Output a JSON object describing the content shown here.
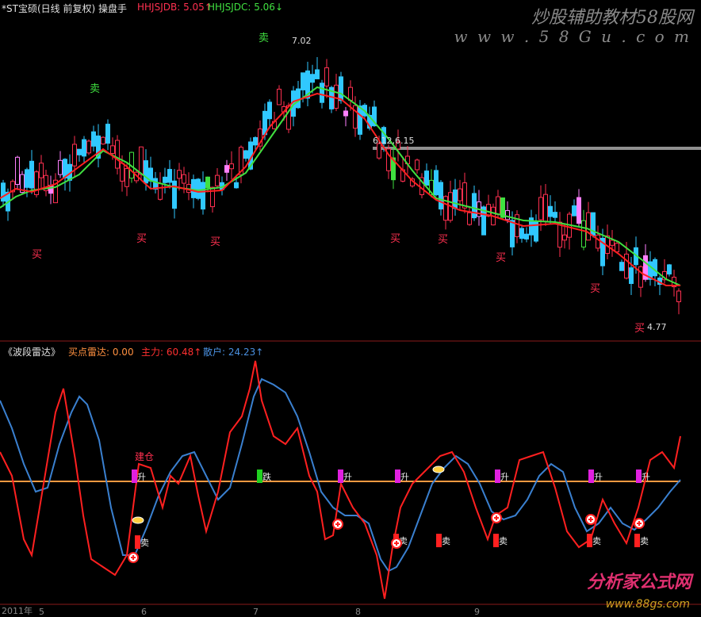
{
  "header": {
    "stock": "*ST宝硕(日线 前复权) 操盘手",
    "ind1": "HHJSJDB: 5.05↑",
    "ind2": "HHJSJDC: 5.06↓"
  },
  "sub_header": {
    "name": "《波段雷达》",
    "ind1": "买点雷达: 0.00",
    "ind2": "主力: 60.48↑",
    "ind3": "散户: 24.23↑"
  },
  "watermark": {
    "top_text": "炒股辅助教材58股网",
    "top_url": "w w w . 5 8 G u . c o m",
    "bottom_text": "分析家公式网",
    "bottom_url": "www.88gs.com"
  },
  "x_labels": [
    "2011年",
    "5",
    "6",
    "7",
    "8",
    "9"
  ],
  "colors": {
    "up": "#ff3050",
    "down": "#30c8ff",
    "ma_fast": "#ff2020",
    "ma_slow": "#40e040",
    "main_force": "#ff2020",
    "retail": "#3a80d0",
    "baseline": "#ff9940"
  },
  "chart_data": [
    {
      "type": "candlestick",
      "title": "*ST宝硕(日线 前复权) 操盘手",
      "annotations": {
        "high": "7.02",
        "level": "6.12,6.15",
        "low": "4.77"
      },
      "signals": [
        {
          "text": "卖",
          "color": "#40e040"
        },
        {
          "text": "卖",
          "color": "#40e040"
        },
        {
          "text": "买",
          "color": "#ff3050"
        },
        {
          "text": "买",
          "color": "#ff3050"
        },
        {
          "text": "买",
          "color": "#ff3050"
        },
        {
          "text": "买",
          "color": "#ff3050"
        },
        {
          "text": "买",
          "color": "#ff3050"
        },
        {
          "text": "买",
          "color": "#ff3050"
        },
        {
          "text": "买",
          "color": "#ff3050"
        },
        {
          "text": "买",
          "color": "#ff3050"
        }
      ]
    },
    {
      "type": "line",
      "title": "《波段雷达》",
      "series": [
        {
          "name": "主力",
          "last": 60.48
        },
        {
          "name": "散户",
          "last": 24.23
        }
      ],
      "markers": [
        "升",
        "跌",
        "升",
        "升",
        "升",
        "升",
        "升",
        "建仓",
        "卖",
        "卖",
        "卖",
        "卖",
        "卖",
        "卖"
      ]
    }
  ]
}
